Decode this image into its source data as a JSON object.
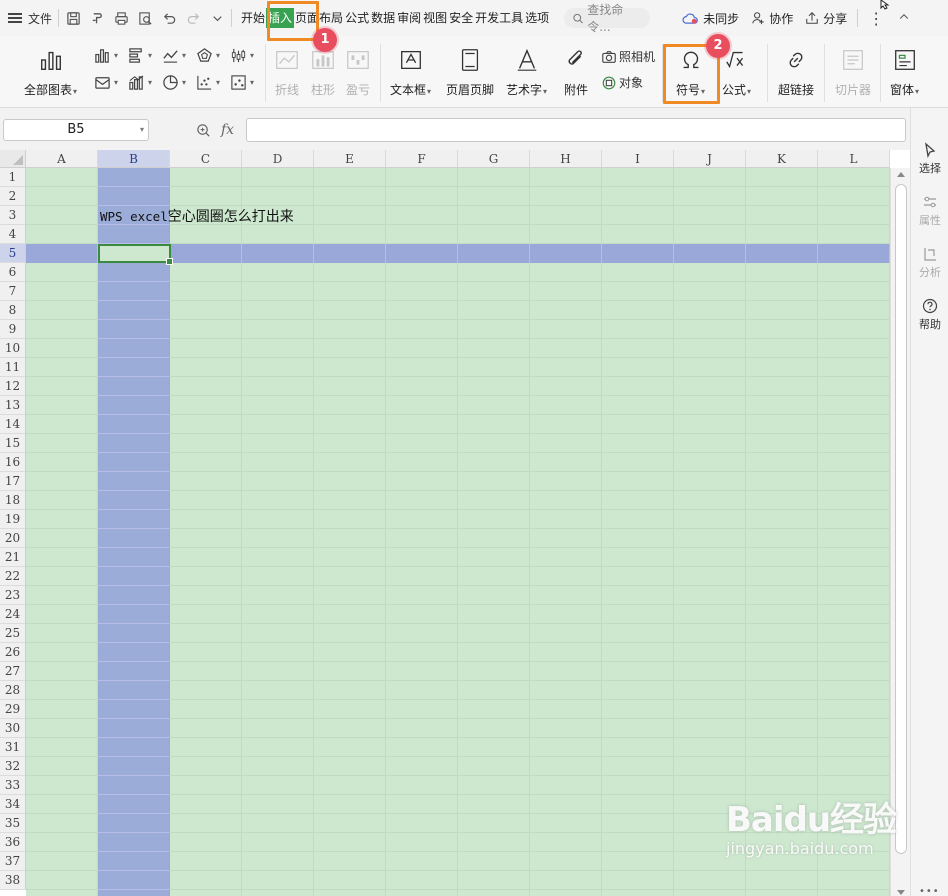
{
  "menubar": {
    "file_label": "文件",
    "tabs": [
      {
        "label": "开始"
      },
      {
        "label": "插入",
        "active": true
      },
      {
        "label": "页面布局"
      },
      {
        "label": "公式"
      },
      {
        "label": "数据"
      },
      {
        "label": "审阅"
      },
      {
        "label": "视图"
      },
      {
        "label": "安全"
      },
      {
        "label": "开发工具"
      },
      {
        "label": "选项"
      }
    ],
    "search_placeholder": "查找命令...",
    "unsynced_label": "未同步",
    "collab_label": "协作",
    "share_label": "分享"
  },
  "ribbon": {
    "all_charts": "全部图表",
    "sparkline_line": "折线",
    "sparkline_column": "柱形",
    "sparkline_winloss": "盈亏",
    "textbox": "文本框",
    "header_footer": "页眉页脚",
    "wordart": "艺术字",
    "attachment": "附件",
    "camera": "照相机",
    "object": "对象",
    "symbol": "符号",
    "formula": "公式",
    "hyperlink": "超链接",
    "slicer": "切片器",
    "window": "窗体"
  },
  "formula_bar": {
    "name_box": "B5",
    "fx_label": "fx",
    "content": ""
  },
  "sheet": {
    "columns": [
      "A",
      "B",
      "C",
      "D",
      "E",
      "F",
      "G",
      "H",
      "I",
      "J",
      "K",
      "L"
    ],
    "rows": [
      "1",
      "2",
      "3",
      "4",
      "5",
      "6",
      "7",
      "8",
      "9",
      "10",
      "11",
      "12",
      "13",
      "14",
      "15",
      "16",
      "17",
      "18",
      "19",
      "20",
      "21",
      "22",
      "23",
      "24",
      "25",
      "26",
      "27",
      "28",
      "29",
      "30",
      "31",
      "32",
      "33",
      "34",
      "35",
      "36",
      "37",
      "38"
    ],
    "selected_column": "B",
    "selected_row": "5",
    "cell_b3_latin": "WPS excel",
    "cell_b3_cjk": "空心圆圈怎么打出来"
  },
  "sidepanel": {
    "select": "选择",
    "properties": "属性",
    "analysis": "分析",
    "help": "帮助"
  },
  "annotations": {
    "step1": "1",
    "step2": "2",
    "highlight_color": "#f08a24",
    "badge_color": "#e94e5f"
  },
  "watermark": {
    "logo_text": "Baidu经验",
    "url": "jingyan.baidu.com"
  },
  "colors": {
    "active_tab": "#37a24f",
    "grid_fill": "#cde8cf",
    "selection_fill": "#8f9cda"
  }
}
